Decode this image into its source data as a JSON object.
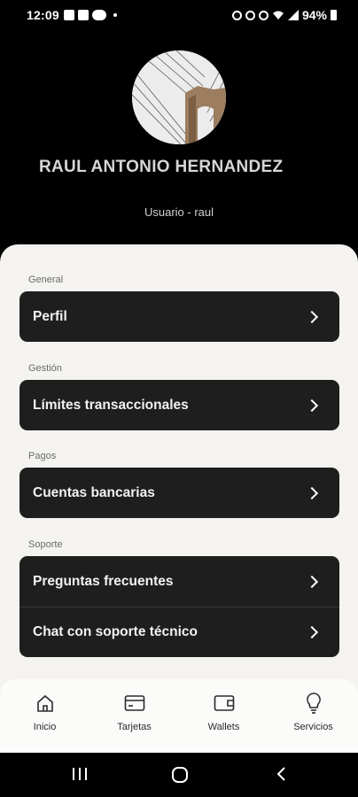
{
  "status_bar": {
    "time": "12:09",
    "battery": "94%"
  },
  "profile": {
    "name": "RAUL ANTONIO HERNANDEZ",
    "handle": "Usuario - raul"
  },
  "sections": [
    {
      "label": "General",
      "items": [
        "Perfil"
      ]
    },
    {
      "label": "Gestión",
      "items": [
        "Límites transaccionales"
      ]
    },
    {
      "label": "Pagos",
      "items": [
        "Cuentas bancarias"
      ]
    },
    {
      "label": "Soporte",
      "items": [
        "Preguntas frecuentes",
        "Chat con soporte técnico"
      ]
    }
  ],
  "bottom_nav": [
    {
      "label": "Inicio",
      "icon": "home-icon"
    },
    {
      "label": "Tarjetas",
      "icon": "card-icon"
    },
    {
      "label": "Wallets",
      "icon": "wallet-icon"
    },
    {
      "label": "Servicios",
      "icon": "lightbulb-icon"
    }
  ],
  "colors": {
    "background": "#000000",
    "sheet": "#f4f3ef",
    "card": "#1e1e1e"
  }
}
